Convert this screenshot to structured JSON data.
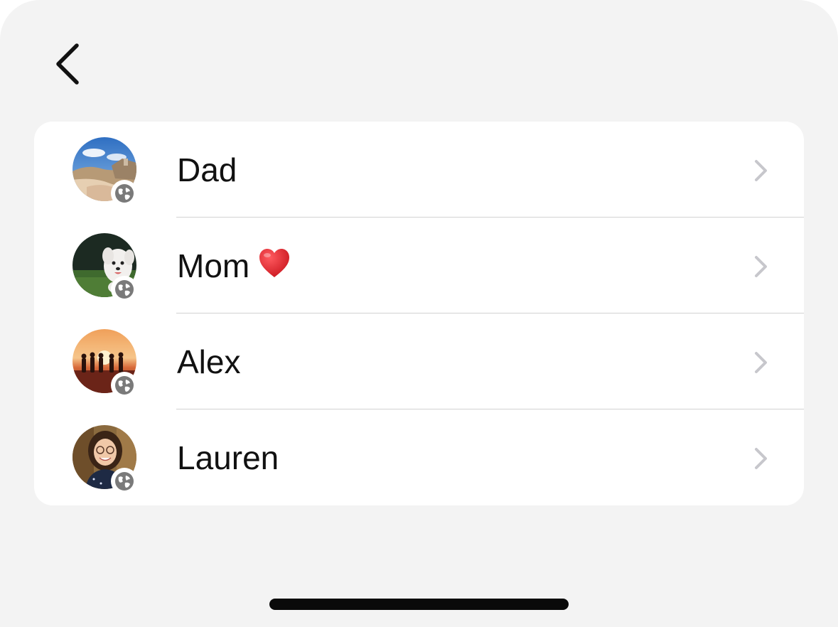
{
  "contacts": [
    {
      "name": "Dad",
      "avatar": "beach-cliff-photo",
      "badge": "globe-icon"
    },
    {
      "name": "Mom",
      "emoji": "heart",
      "avatar": "white-dog-photo",
      "badge": "globe-icon"
    },
    {
      "name": "Alex",
      "avatar": "sunset-silhouettes-photo",
      "badge": "globe-icon"
    },
    {
      "name": "Lauren",
      "avatar": "smiling-woman-photo",
      "badge": "globe-icon"
    }
  ],
  "colors": {
    "background": "#f3f3f3",
    "card": "#ffffff",
    "text": "#111111",
    "chevron": "#c7c7cc",
    "badge_globe": "#7a7a7a",
    "heart": "#e0242c"
  }
}
